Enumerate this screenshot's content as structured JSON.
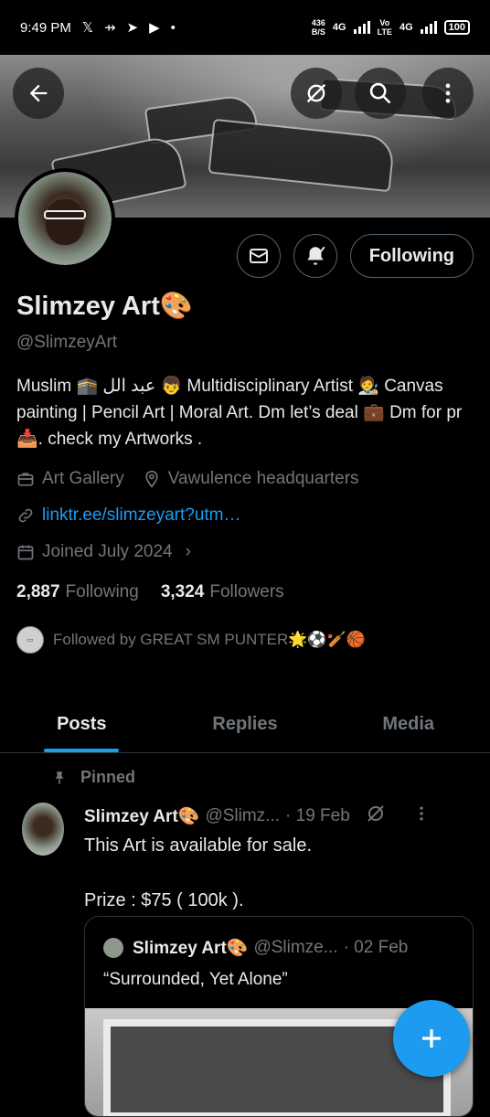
{
  "status_bar": {
    "time": "9:49 PM",
    "speed_value": "436",
    "speed_unit": "B/S",
    "network1": "4G",
    "network2_top": "Vo",
    "network2_bottom": "LTE",
    "network3": "4G",
    "battery": "100"
  },
  "profile": {
    "display_name": "Slimzey Art🎨",
    "handle": "@SlimzeyArt",
    "bio": "Muslim 🕋 عبد الل 👦 Multidisciplinary Artist 🧑‍🎨 Canvas painting | Pencil Art | Moral Art. Dm let’s deal 💼 Dm for pr 📥. check my Artworks .",
    "category": "Art Gallery",
    "location": "Vawulence headquarters",
    "link": "linktr.ee/slimzeyart?utm…",
    "joined": "Joined July 2024",
    "following_count": "2,887",
    "following_label": "Following",
    "followers_count": "3,324",
    "followers_label": "Followers",
    "followed_by": "Followed by GREAT SM PUNTER🌟⚽🏏🏀",
    "following_button": "Following"
  },
  "tabs": [
    {
      "label": "Posts",
      "active": true
    },
    {
      "label": "Replies",
      "active": false
    },
    {
      "label": "Media",
      "active": false
    }
  ],
  "post": {
    "pinned_label": "Pinned",
    "author_name": "Slimzey Art🎨",
    "author_handle": "@Slimz...",
    "date": "· 19 Feb",
    "text": "This Art is available for sale.\n\nPrize : $75 ( 100k ).",
    "quote": {
      "author_name": "Slimzey Art🎨",
      "author_handle": "@Slimze...",
      "date": "· 02 Feb",
      "text": "“Surrounded, Yet Alone”"
    }
  },
  "colors": {
    "accent": "#1d9bf0",
    "text_primary": "#e7e9ea",
    "text_secondary": "#71767b",
    "background": "#000000",
    "border": "#2f3336"
  }
}
